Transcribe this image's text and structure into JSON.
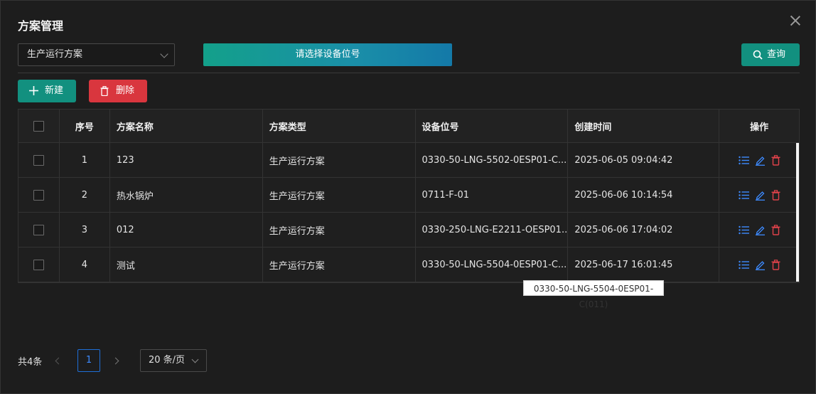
{
  "dialog": {
    "title": "方案管理"
  },
  "filters": {
    "plan_select": "生产运行方案",
    "device_button": "请选择设备位号",
    "query_label": "查询"
  },
  "toolbar": {
    "new_label": "新建",
    "delete_label": "删除"
  },
  "table": {
    "headers": {
      "index": "序号",
      "name": "方案名称",
      "type": "方案类型",
      "device": "设备位号",
      "created": "创建时间",
      "ops": "操作"
    },
    "rows": [
      {
        "index": "1",
        "name": "123",
        "type": "生产运行方案",
        "device": "0330-50-LNG-5502-0ESP01-C...",
        "created": "2025-06-05 09:04:42"
      },
      {
        "index": "2",
        "name": "热水锅炉",
        "type": "生产运行方案",
        "device": "0711-F-01",
        "created": "2025-06-06 10:14:54"
      },
      {
        "index": "3",
        "name": "012",
        "type": "生产运行方案",
        "device": "0330-250-LNG-E2211-OESP01...",
        "created": "2025-06-06 17:04:02"
      },
      {
        "index": "4",
        "name": "测试",
        "type": "生产运行方案",
        "device": "0330-50-LNG-5504-0ESP01-C...",
        "created": "2025-06-17 16:01:45"
      }
    ]
  },
  "tooltip": "0330-50-LNG-5504-0ESP01-C(011)",
  "pagination": {
    "total": "共4条",
    "current_page": "1",
    "page_size": "20 条/页"
  },
  "colors": {
    "accent": "#12907f",
    "danger": "#d9363e",
    "link_blue": "#3d8bff",
    "delete_red": "#e0424a"
  }
}
